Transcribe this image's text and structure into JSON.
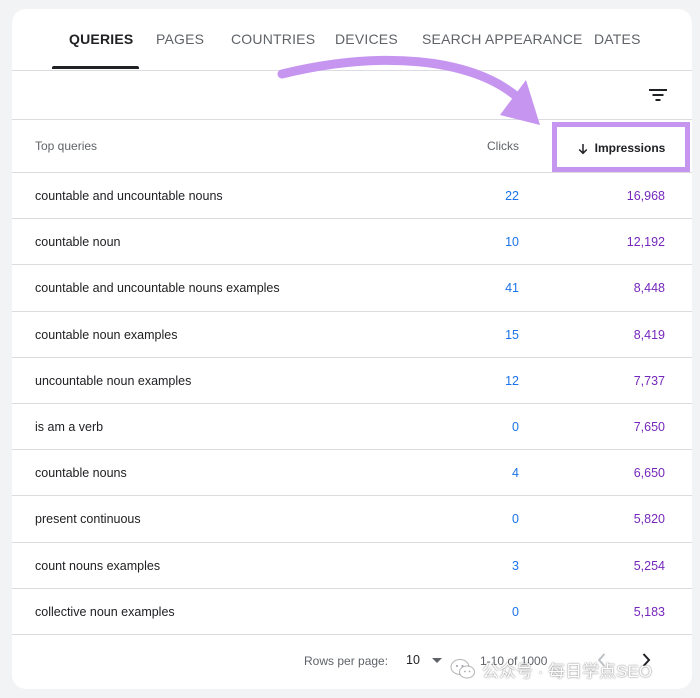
{
  "tabs": [
    {
      "label": "QUERIES",
      "active": true
    },
    {
      "label": "PAGES",
      "active": false
    },
    {
      "label": "COUNTRIES",
      "active": false
    },
    {
      "label": "DEVICES",
      "active": false
    },
    {
      "label": "SEARCH APPEARANCE",
      "active": false
    },
    {
      "label": "DATES",
      "active": false
    }
  ],
  "toolbar": {
    "filter_icon": "filter-icon"
  },
  "table": {
    "headers": {
      "query": "Top queries",
      "clicks": "Clicks",
      "impressions": "Impressions"
    },
    "sort": {
      "column": "impressions",
      "direction": "descending",
      "icon": "arrow-down-icon"
    },
    "rows": [
      {
        "query": "countable and uncountable nouns",
        "clicks": "22",
        "impressions": "16,968"
      },
      {
        "query": "countable noun",
        "clicks": "10",
        "impressions": "12,192"
      },
      {
        "query": "countable and uncountable nouns examples",
        "clicks": "41",
        "impressions": "8,448"
      },
      {
        "query": "countable noun examples",
        "clicks": "15",
        "impressions": "8,419"
      },
      {
        "query": "uncountable noun examples",
        "clicks": "12",
        "impressions": "7,737"
      },
      {
        "query": "is am a verb",
        "clicks": "0",
        "impressions": "7,650"
      },
      {
        "query": "countable nouns",
        "clicks": "4",
        "impressions": "6,650"
      },
      {
        "query": "present continuous",
        "clicks": "0",
        "impressions": "5,820"
      },
      {
        "query": "count nouns examples",
        "clicks": "3",
        "impressions": "5,254"
      },
      {
        "query": "collective noun examples",
        "clicks": "0",
        "impressions": "5,183"
      }
    ]
  },
  "footer": {
    "rows_per_page_label": "Rows per page:",
    "rows_per_page_value": "10",
    "range": "1-10 of 1000"
  },
  "watermark": {
    "text": "公众号 · 每日学点SEO",
    "icon": "wechat-icon"
  },
  "colors": {
    "clicks": "#1a73e8",
    "impressions": "#7627bb",
    "highlight": "#c695f0"
  }
}
